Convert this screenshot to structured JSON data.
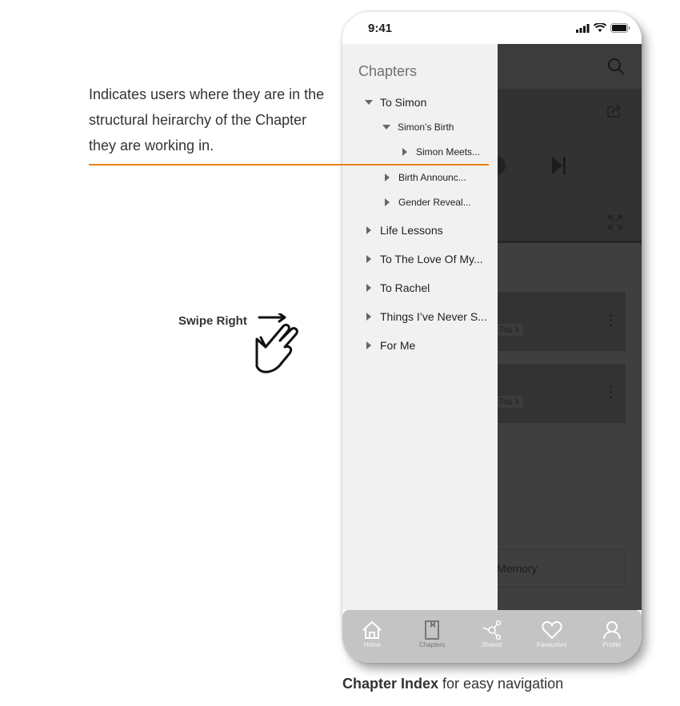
{
  "annotation": {
    "text": "Indicates users where they are in the structural heirarchy of the Chapter they are working in.",
    "line_color": "#e8820c"
  },
  "gesture": {
    "label": "Swipe Right",
    "icon": "swipe-right-hand-icon"
  },
  "caption": {
    "bold": "Chapter Index",
    "rest": " for easy navigation"
  },
  "phone": {
    "status_bar": {
      "time": "9:41",
      "icons": [
        "signal-icon",
        "wifi-icon",
        "battery-icon"
      ]
    },
    "background_screen": {
      "top_icons": [
        "search-icon"
      ],
      "player_icons": [
        "share-icon",
        "play-icon",
        "skip-next-icon",
        "expand-icon"
      ],
      "cards": [
        {
          "tag": "Tag 3"
        },
        {
          "tag": "Tag 3"
        }
      ],
      "memory_button": "Memory"
    },
    "drawer": {
      "title": "Chapters",
      "items": [
        {
          "label": "To Simon",
          "level": 0,
          "expanded": true
        },
        {
          "label": "Simon’s Birth",
          "level": 1,
          "expanded": true
        },
        {
          "label": "Simon Meets...",
          "level": 2,
          "expanded": false
        },
        {
          "label": "Birth Announc...",
          "level": 1,
          "expanded": false
        },
        {
          "label": "Gender Reveal...",
          "level": 1,
          "expanded": false
        },
        {
          "label": "Life Lessons",
          "level": 0,
          "expanded": false
        },
        {
          "label": "To The Love Of My...",
          "level": 0,
          "expanded": false
        },
        {
          "label": "To Rachel",
          "level": 0,
          "expanded": false
        },
        {
          "label": "Things I’ve Never S...",
          "level": 0,
          "expanded": false
        },
        {
          "label": "For Me",
          "level": 0,
          "expanded": false
        }
      ]
    },
    "bottom_nav": {
      "active": "Chapters",
      "items": [
        {
          "label": "Home",
          "icon": "home-icon"
        },
        {
          "label": "Chapters",
          "icon": "book-icon"
        },
        {
          "label": "Shared",
          "icon": "share-nodes-icon"
        },
        {
          "label": "Favourites",
          "icon": "heart-icon"
        },
        {
          "label": "Profile",
          "icon": "profile-icon"
        }
      ]
    }
  }
}
